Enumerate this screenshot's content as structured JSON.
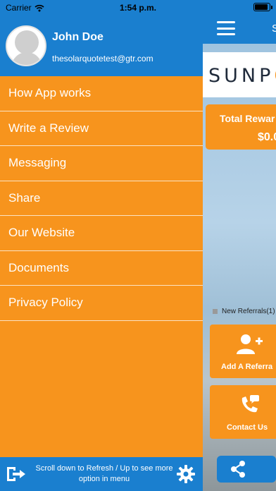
{
  "status_bar": {
    "carrier": "Carrier",
    "time": "1:54 p.m."
  },
  "drawer": {
    "user": {
      "name": "John Doe",
      "email": "thesolarquotetest@gtr.com"
    },
    "menu_items": [
      {
        "label": "How App works"
      },
      {
        "label": "Write a Review"
      },
      {
        "label": "Messaging"
      },
      {
        "label": "Share"
      },
      {
        "label": "Our Website"
      },
      {
        "label": "Documents"
      },
      {
        "label": "Privacy Policy"
      }
    ],
    "footer": {
      "hint": "Scroll down to Refresh / Up to see more option in menu"
    }
  },
  "main": {
    "screen_title": "S",
    "logo": {
      "prefix": "SUNP",
      "accent": "O"
    },
    "rewards": {
      "label": "Total Rewar",
      "value": "$0.0"
    },
    "legend": "New Referrals(1)",
    "tiles": [
      {
        "label": "Add A Referra",
        "icon": "add-user-icon"
      },
      {
        "label": "Contact Us",
        "icon": "phone-message-icon"
      }
    ],
    "share_icon": "share-icon"
  },
  "colors": {
    "brand_blue": "#1a7fcf",
    "brand_orange": "#f7941d"
  }
}
